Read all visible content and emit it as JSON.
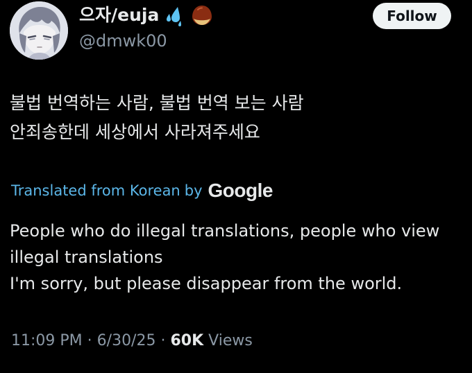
{
  "author": {
    "display_name": "으자/euja",
    "handle": "@dmwk00",
    "badges": [
      "sweat-droplets-icon",
      "chestnut-icon"
    ]
  },
  "follow_button": {
    "label": "Follow"
  },
  "post": {
    "original_lines": [
      "불법 번역하는 사람, 불법 번역 보는 사람",
      "안죄송한데 세상에서 사라져주세요"
    ],
    "translation_notice": "Translated from Korean",
    "translation_by": "by",
    "translation_provider": "Google",
    "translated_lines": [
      "People who do illegal translations, people who view",
      "illegal translations",
      "I'm sorry, but please disappear from the world."
    ]
  },
  "meta": {
    "time": "11:09 PM",
    "separator": "·",
    "date": "6/30/25",
    "views_count": "60K",
    "views_label": "Views"
  },
  "colors": {
    "background": "#000000",
    "text": "#e7e9ea",
    "muted": "#8b98a5",
    "link": "#5bb6e8",
    "follow_bg": "#eff3f4"
  }
}
